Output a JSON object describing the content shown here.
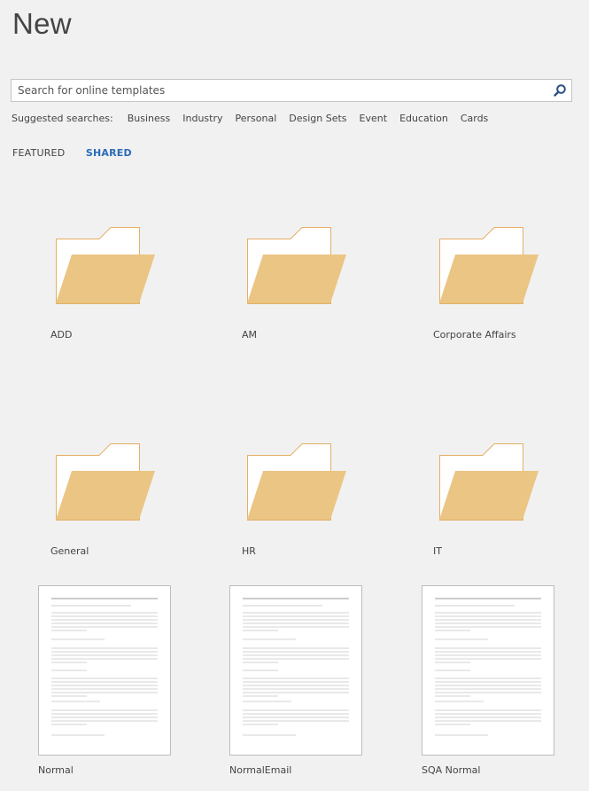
{
  "header": {
    "title": "New"
  },
  "search": {
    "placeholder": "Search for online templates"
  },
  "suggested": {
    "label": "Suggested searches:",
    "items": [
      "Business",
      "Industry",
      "Personal",
      "Design Sets",
      "Event",
      "Education",
      "Cards"
    ]
  },
  "tabs": [
    {
      "label": "FEATURED",
      "active": false
    },
    {
      "label": "SHARED",
      "active": true
    }
  ],
  "folders": [
    {
      "label": "ADD"
    },
    {
      "label": "AM"
    },
    {
      "label": "Corporate Affairs"
    },
    {
      "label": "General"
    },
    {
      "label": "HR"
    },
    {
      "label": "IT"
    }
  ],
  "documents": [
    {
      "label": "Normal"
    },
    {
      "label": "NormalEmail"
    },
    {
      "label": "SQA Normal"
    }
  ],
  "colors": {
    "folder_front": "#ebc584",
    "folder_outline": "#e4b064",
    "accent": "#2b6cb8"
  }
}
